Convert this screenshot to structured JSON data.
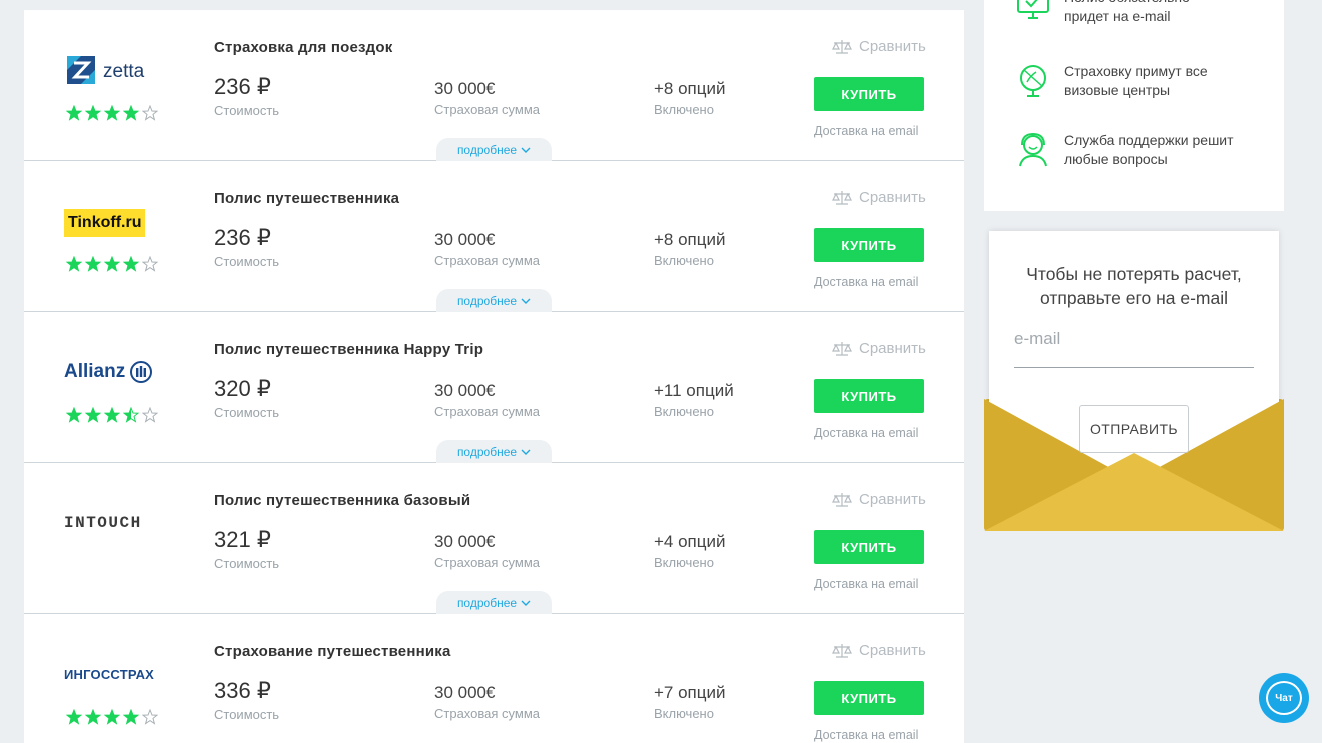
{
  "offers": [
    {
      "insurer": "zetta",
      "title": "Страховка для поездок",
      "price": "236 ₽",
      "price_label": "Стоимость",
      "sum": "30 000€",
      "sum_label": "Страховая сумма",
      "options": "+8 опций",
      "options_label": "Включено",
      "compare": "Сравнить",
      "buy": "КУПИТЬ",
      "delivery": "Доставка на email",
      "more": "подробнее",
      "rating": 4
    },
    {
      "insurer": "Tinkoff.ru",
      "title": "Полис путешественника",
      "price": "236 ₽",
      "price_label": "Стоимость",
      "sum": "30 000€",
      "sum_label": "Страховая сумма",
      "options": "+8 опций",
      "options_label": "Включено",
      "compare": "Сравнить",
      "buy": "КУПИТЬ",
      "delivery": "Доставка на email",
      "more": "подробнее",
      "rating": 4
    },
    {
      "insurer": "Allianz",
      "title": "Полис путешественника Happy Trip",
      "price": "320 ₽",
      "price_label": "Стоимость",
      "sum": "30 000€",
      "sum_label": "Страховая сумма",
      "options": "+11 опций",
      "options_label": "Включено",
      "compare": "Сравнить",
      "buy": "КУПИТЬ",
      "delivery": "Доставка на email",
      "more": "подробнее",
      "rating": 3.5
    },
    {
      "insurer": "INTOUCH",
      "title": "Полис путешественника базовый",
      "price": "321 ₽",
      "price_label": "Стоимость",
      "sum": "30 000€",
      "sum_label": "Страховая сумма",
      "options": "+4 опций",
      "options_label": "Включено",
      "compare": "Сравнить",
      "buy": "КУПИТЬ",
      "delivery": "Доставка на email",
      "more": "подробнее",
      "rating": 0
    },
    {
      "insurer": "ИНГОССТРАХ",
      "title": "Страхование путешественника",
      "price": "336 ₽",
      "price_label": "Стоимость",
      "sum": "30 000€",
      "sum_label": "Страховая сумма",
      "options": "+7 опций",
      "options_label": "Включено",
      "compare": "Сравнить",
      "buy": "КУПИТЬ",
      "delivery": "Доставка на email",
      "more": "подробнее",
      "rating": 4
    }
  ],
  "features": [
    {
      "icon": "monitor-check-icon",
      "text": "Полис обязательно придет на e-mail"
    },
    {
      "icon": "globe-icon",
      "text": "Страховку примут все визовые центры"
    },
    {
      "icon": "support-agent-icon",
      "text": "Служба поддержки решит любые вопросы"
    }
  ],
  "email_form": {
    "heading": "Чтобы не потерять расчет, отправьте его на e-mail",
    "placeholder": "e-mail",
    "send": "ОТПРАВИТЬ"
  },
  "chat": {
    "label": "Чат"
  },
  "colors": {
    "accent_green": "#1bd55b",
    "link_blue": "#20a9e0",
    "envelope_gold": "#d6ac2e",
    "chat_blue": "#1aa7e8"
  }
}
